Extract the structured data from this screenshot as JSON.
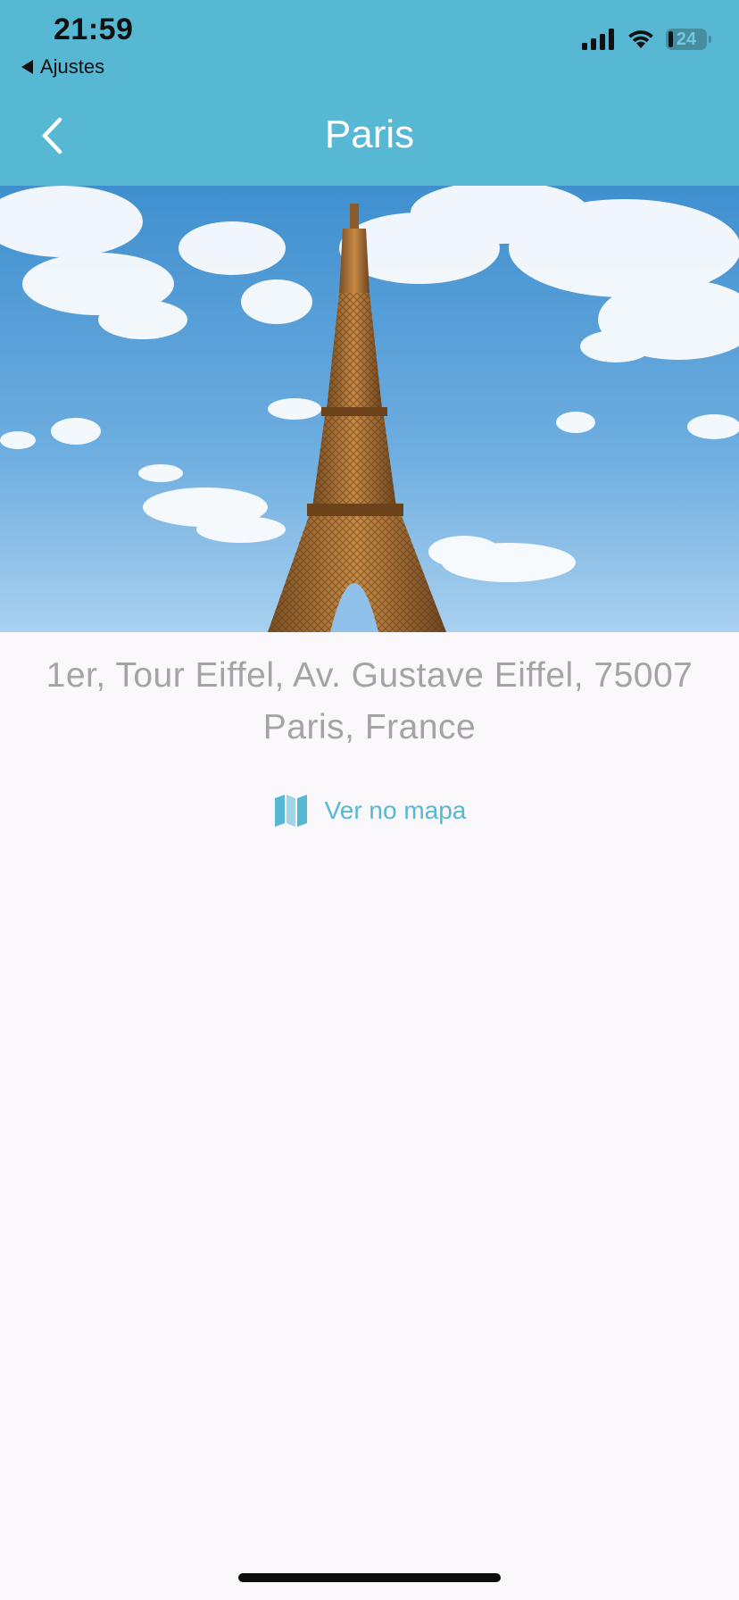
{
  "status_bar": {
    "time": "21:59",
    "back_app": "Ajustes",
    "battery_level": "24"
  },
  "header": {
    "title": "Paris",
    "color": "#56b8d2"
  },
  "hero_image": {
    "subject": "eiffel-tower"
  },
  "place": {
    "address_line1": "1er, Tour Eiffel, Av. Gustave Eiffel, 75007",
    "address_line2": "Paris, France"
  },
  "actions": {
    "map_link_label": "Ver no mapa",
    "map_icon": "map-icon"
  },
  "colors": {
    "accent": "#56b8d2",
    "address_text": "#a3a3a8",
    "background": "#fbf8fc"
  }
}
